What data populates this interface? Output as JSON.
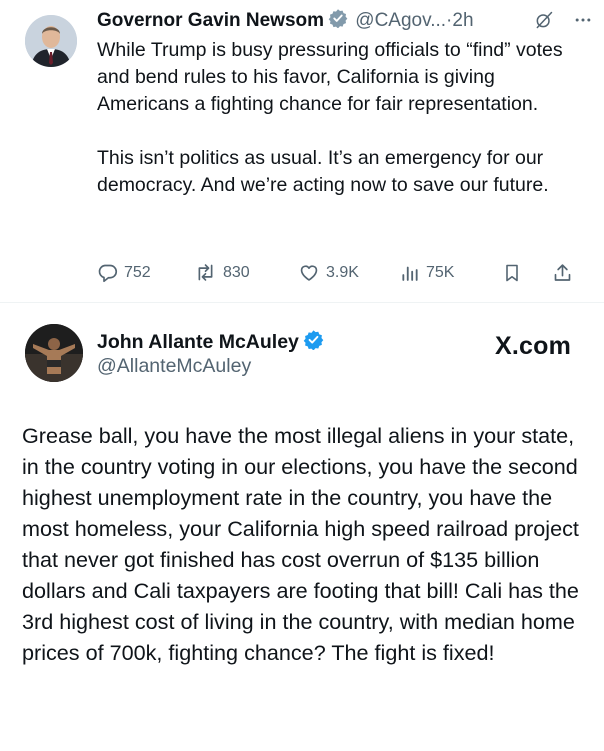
{
  "tweet1": {
    "author_name": "Governor Gavin Newsom",
    "handle": "@CAgov...",
    "separator": "·",
    "time": "2h",
    "body_paragraphs": [
      "While Trump is busy pressuring officials to “find” votes and bend rules to his favor, California is giving Americans a fighting chance for fair representation.",
      "This isn’t politics as usual. It’s an emergency for our democracy. And we’re acting now to save our future."
    ],
    "stats": {
      "replies": "752",
      "reposts": "830",
      "likes": "3.9K",
      "views": "75K"
    },
    "badge_color": "#829aab"
  },
  "tweet2": {
    "author_name": "John Allante McAuley",
    "handle": "@AllanteMcAuley",
    "watermark": "X.com",
    "body": "Grease ball, you have the most illegal aliens in your state, in the country voting in our elections, you have the second highest unemployment rate in the country, you have the most homeless, your California high speed railroad project that never got finished has cost overrun of $135 billion dollars and Cali taxpayers are footing that bill! Cali has the 3rd highest cost of living in the country, with median home prices of 700k,  fighting chance? The fight is fixed!",
    "badge_color": "#1d9bf0"
  },
  "icons": [
    "grok-icon",
    "more-icon",
    "reply-icon",
    "repost-icon",
    "like-icon",
    "views-icon",
    "bookmark-icon",
    "share-icon"
  ],
  "colors": {
    "text": "#0f1419",
    "secondary": "#536471",
    "verified": "#1d9bf0",
    "gov_verified": "#829aab"
  }
}
